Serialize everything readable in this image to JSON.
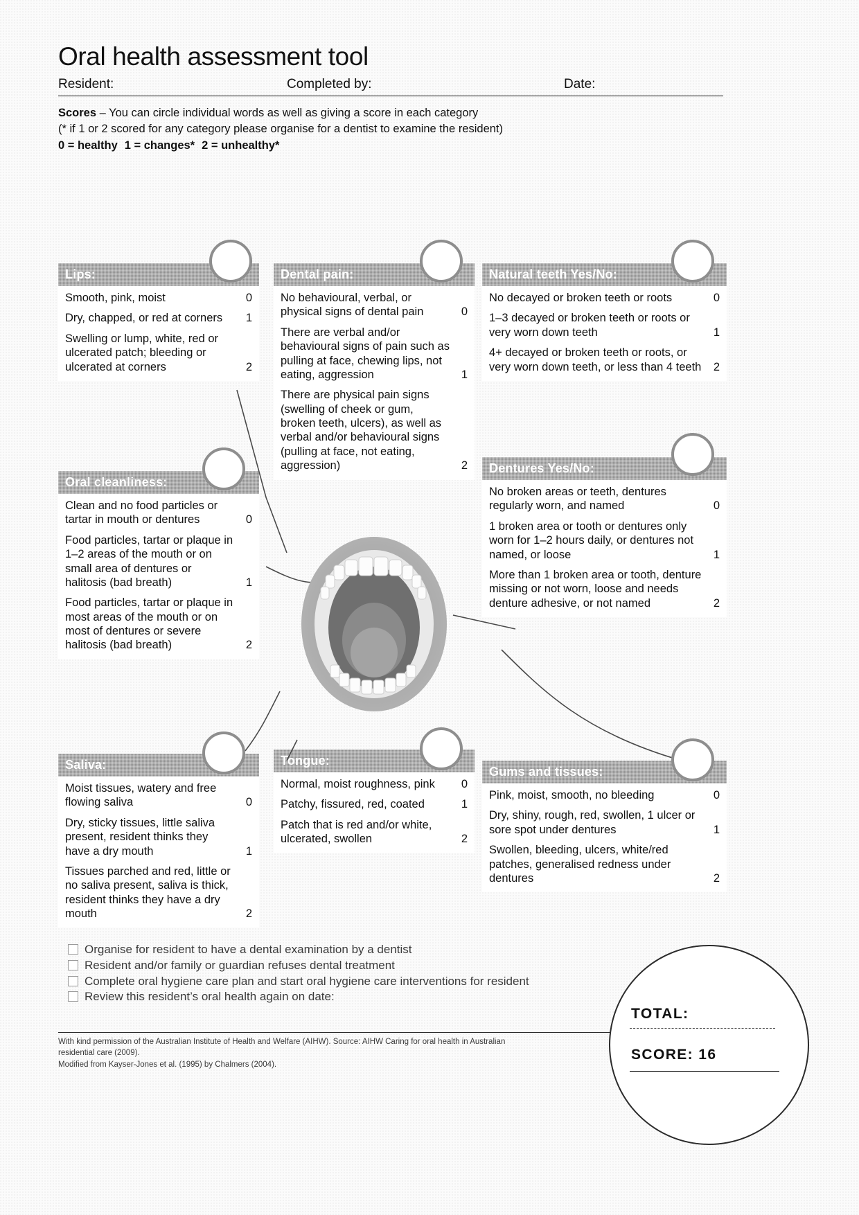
{
  "header": {
    "title": "Oral health assessment tool",
    "fields": [
      {
        "label": "Resident:"
      },
      {
        "label": "Completed by:"
      },
      {
        "label": "Date:"
      }
    ],
    "scores_line1_bold": "Scores",
    "scores_line1_rest": " – You can circle individual words as well as giving a score in each category",
    "scores_line2": "(* if 1 or 2 scored for any category please organise for a dentist to examine the resident)",
    "scores_legend": [
      "0 = healthy",
      "1 = changes*",
      "2 = unhealthy*"
    ]
  },
  "cards": [
    {
      "id": "lips",
      "heading": "Lips:",
      "options": [
        {
          "text": "Smooth, pink, moist",
          "score": "0"
        },
        {
          "text": "Dry, chapped, or red at corners",
          "score": "1"
        },
        {
          "text": "Swelling or lump, white, red or ulcerated patch; bleeding or ulcerated at corners",
          "score": "2"
        }
      ]
    },
    {
      "id": "oral-cleanliness",
      "heading": "Oral cleanliness:",
      "options": [
        {
          "text": "Clean and no food particles or tartar in mouth or dentures",
          "score": "0"
        },
        {
          "text": "Food particles, tartar or plaque in 1–2 areas of the mouth or on small area of dentures or halitosis (bad breath)",
          "score": "1"
        },
        {
          "text": "Food particles, tartar or plaque in most areas of the mouth or on most of dentures or severe halitosis (bad breath)",
          "score": "2"
        }
      ]
    },
    {
      "id": "saliva",
      "heading": "Saliva:",
      "options": [
        {
          "text": "Moist tissues, watery and free flowing saliva",
          "score": "0"
        },
        {
          "text": "Dry, sticky tissues, little saliva present, resident thinks they have a dry mouth",
          "score": "1"
        },
        {
          "text": "Tissues parched and red, little or no saliva present, saliva is thick, resident thinks they have a dry mouth",
          "score": "2"
        }
      ]
    },
    {
      "id": "dental-pain",
      "heading": "Dental pain:",
      "options": [
        {
          "text": "No behavioural, verbal, or physical signs of dental pain",
          "score": "0"
        },
        {
          "text": "There are verbal and/or behavioural signs of pain such as pulling at face, chewing lips, not eating, aggression",
          "score": "1"
        },
        {
          "text": "There are physical pain signs (swelling of cheek or gum, broken teeth, ulcers), as well as verbal and/or behavioural signs (pulling at face, not eating, aggression)",
          "score": "2"
        }
      ]
    },
    {
      "id": "tongue",
      "heading": "Tongue:",
      "options": [
        {
          "text": "Normal, moist roughness, pink",
          "score": "0"
        },
        {
          "text": "Patchy, fissured, red, coated",
          "score": "1"
        },
        {
          "text": "Patch that is red and/or white, ulcerated, swollen",
          "score": "2"
        }
      ]
    },
    {
      "id": "natural-teeth",
      "heading": "Natural teeth  Yes/No:",
      "options": [
        {
          "text": "No decayed or broken teeth or roots",
          "score": "0"
        },
        {
          "text": "1–3 decayed or broken teeth or roots or very worn down teeth",
          "score": "1"
        },
        {
          "text": "4+ decayed or broken teeth or roots, or very worn down teeth, or less than 4 teeth",
          "score": "2"
        }
      ]
    },
    {
      "id": "dentures",
      "heading": "Dentures   Yes/No:",
      "options": [
        {
          "text": "No broken areas or teeth, dentures regularly worn, and named",
          "score": "0"
        },
        {
          "text": "1 broken area or tooth or dentures only worn for 1–2 hours daily, or dentures not named, or loose",
          "score": "1"
        },
        {
          "text": "More than 1 broken area  or tooth, denture missing or not worn, loose and needs denture adhesive, or not  named",
          "score": "2"
        }
      ]
    },
    {
      "id": "gums-and-tissues",
      "heading": "Gums and tissues:",
      "options": [
        {
          "text": "Pink, moist, smooth, no bleeding",
          "score": "0"
        },
        {
          "text": "Dry, shiny, rough, red, swollen, 1 ulcer or sore spot under dentures",
          "score": "1"
        },
        {
          "text": "Swollen, bleeding, ulcers, white/red patches, generalised redness under dentures",
          "score": "2"
        }
      ]
    }
  ],
  "actions": [
    "Organise for resident to have a dental examination by a dentist",
    "Resident and/or family or guardian refuses dental treatment",
    "Complete oral hygiene care plan and start oral hygiene care interventions for resident",
    "Review this resident’s oral health again on date:"
  ],
  "total_circle": {
    "total_label": "TOTAL:",
    "score_label": "SCORE: 16"
  },
  "footnote": "With kind permission of the Australian Institute of Health and Welfare (AIHW). Source: AIHW Caring for oral health in Australian residential care (2009).\nModified from Kayser-Jones et al. (1995) by Chalmers (2004).",
  "colors": {
    "header_bar": "#8f8f8f",
    "bubble_border": "#8e8e8e",
    "text": "#111111"
  }
}
